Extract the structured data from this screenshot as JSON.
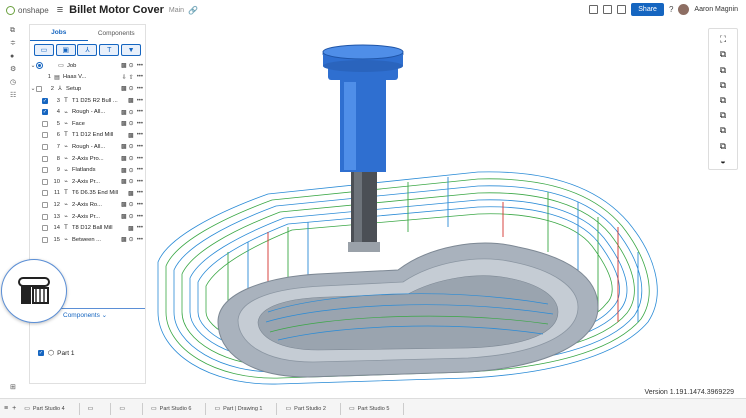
{
  "header": {
    "brand": "onshape",
    "title": "Billet Motor Cover",
    "branch": "Main",
    "share_label": "Share",
    "help_label": "?",
    "user_name": "Aaron Magnin"
  },
  "panel": {
    "tabs": [
      {
        "label": "Jobs",
        "active": true
      },
      {
        "label": "Components",
        "active": false
      }
    ],
    "components_link": "Components",
    "part_label": "Part 1"
  },
  "tree": [
    {
      "num": "",
      "label": "Job",
      "kind": "job"
    },
    {
      "num": "1",
      "label": "Haas V...",
      "kind": "machine"
    },
    {
      "num": "2",
      "label": "Setup",
      "kind": "setup"
    },
    {
      "num": "3",
      "label": "T1 D25 R2 Bull ...",
      "kind": "tool",
      "checked": true
    },
    {
      "num": "4",
      "label": "Rough - All...",
      "kind": "op",
      "checked": true
    },
    {
      "num": "5",
      "label": "Face",
      "kind": "op",
      "checked": false
    },
    {
      "num": "6",
      "label": "T1 D12 End Mill",
      "kind": "tool",
      "checked": false
    },
    {
      "num": "7",
      "label": "Rough - All...",
      "kind": "op",
      "checked": false
    },
    {
      "num": "8",
      "label": "2-Axis Pro...",
      "kind": "op",
      "checked": false
    },
    {
      "num": "9",
      "label": "Flatlands",
      "kind": "op",
      "checked": false
    },
    {
      "num": "10",
      "label": "2-Axis Pr...",
      "kind": "op",
      "checked": false
    },
    {
      "num": "11",
      "label": "T6 D6.35 End Mill",
      "kind": "tool",
      "checked": false
    },
    {
      "num": "12",
      "label": "2-Axis Ro...",
      "kind": "op",
      "checked": false
    },
    {
      "num": "13",
      "label": "2-Axis Pr...",
      "kind": "op",
      "checked": false
    },
    {
      "num": "14",
      "label": "T8 D12 Ball Mill",
      "kind": "tool",
      "checked": false
    },
    {
      "num": "15",
      "label": "Between ...",
      "kind": "op",
      "checked": false
    }
  ],
  "status": {
    "version": "Version 1.191.1474.3969229"
  },
  "bottom_tabs": [
    {
      "label": "Part Studio 4",
      "active": false
    },
    {
      "label": "",
      "active": false
    },
    {
      "label": "",
      "active": false
    },
    {
      "label": "Part Studio 6",
      "active": false
    },
    {
      "label": "Part | Drawing 1",
      "active": false
    },
    {
      "label": "Part Studio 2",
      "active": false
    },
    {
      "label": "Part Studio 5",
      "active": false
    }
  ],
  "colors": {
    "accent": "#1565c0",
    "spindle": "#2f6fd0",
    "part": "#a9b2bd",
    "toolpath_blue": "#2a8bd6",
    "toolpath_green": "#3aa745",
    "toolpath_red": "#d3322c"
  }
}
